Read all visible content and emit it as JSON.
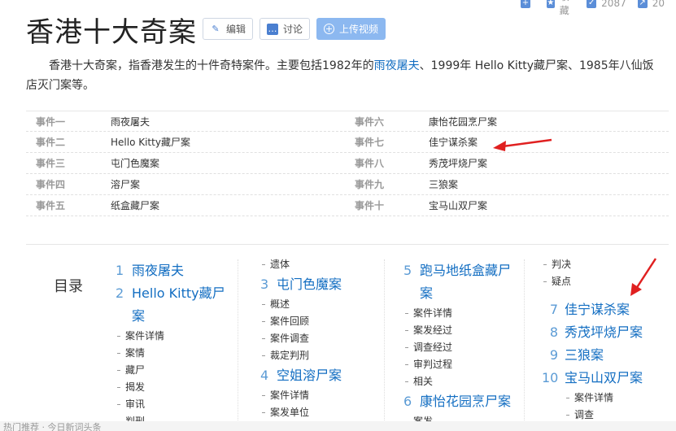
{
  "stats": {
    "collect_label": "收藏",
    "like_count": "2087",
    "share_count": "20"
  },
  "title": "香港十大奇案",
  "buttons": {
    "edit": "编辑",
    "discuss": "讨论",
    "upload": "上传视频"
  },
  "summary": {
    "part1": "香港十大奇案，指香港发生的十件奇特案件。主要包括1982年的",
    "link1": "雨夜屠夫",
    "part2": "、1999年 Hello Kitty藏尸案、1985年八仙饭店灭门案等。"
  },
  "events": [
    {
      "k1": "事件一",
      "v1": "雨夜屠夫",
      "k2": "事件六",
      "v2": "康怡花园烹尸案"
    },
    {
      "k1": "事件二",
      "v1": "Hello Kitty藏尸案",
      "k2": "事件七",
      "v2": "佳宁谋杀案"
    },
    {
      "k1": "事件三",
      "v1": "屯门色魔案",
      "k2": "事件八",
      "v2": "秀茂坪烧尸案"
    },
    {
      "k1": "事件四",
      "v1": "溶尸案",
      "k2": "事件九",
      "v2": "三狼案"
    },
    {
      "k1": "事件五",
      "v1": "纸盒藏尸案",
      "k2": "事件十",
      "v2": "宝马山双尸案"
    }
  ],
  "toc": {
    "label": "目录",
    "col1": {
      "i1_num": "1",
      "i1": "雨夜屠夫",
      "i2_num": "2",
      "i2a": "Hello Kitty藏尸",
      "i2b": "案",
      "subs": [
        "案件详情",
        "案情",
        "藏尸",
        "揭发",
        "审讯",
        "判刑"
      ]
    },
    "col2": {
      "sub0": "遗体",
      "i3_num": "3",
      "i3": "屯门色魔案",
      "subs3": [
        "概述",
        "案件回顾",
        "案件调查",
        "裁定判刑"
      ],
      "i4_num": "4",
      "i4": "空姐溶尸案",
      "subs4": [
        "案件详情",
        "案发单位"
      ]
    },
    "col3": {
      "i5_num": "5",
      "i5a": "跑马地纸盒藏尸",
      "i5b": "案",
      "subs5": [
        "案件详情",
        "案发经过",
        "调查经过",
        "审判过程",
        "相关"
      ],
      "i6_num": "6",
      "i6": "康怡花园烹尸案",
      "subs6": [
        "案发"
      ]
    },
    "col4": {
      "subs0": [
        "判决",
        "疑点"
      ],
      "i7_num": "7",
      "i7": "佳宁谋杀案",
      "i8_num": "8",
      "i8": "秀茂坪烧尸案",
      "i9_num": "9",
      "i9": "三狼案",
      "i10_num": "10",
      "i10": "宝马山双尸案",
      "subs10": [
        "案件详情",
        "调查"
      ]
    }
  },
  "bottom_text": "热门推荐 · 今日新词头条"
}
